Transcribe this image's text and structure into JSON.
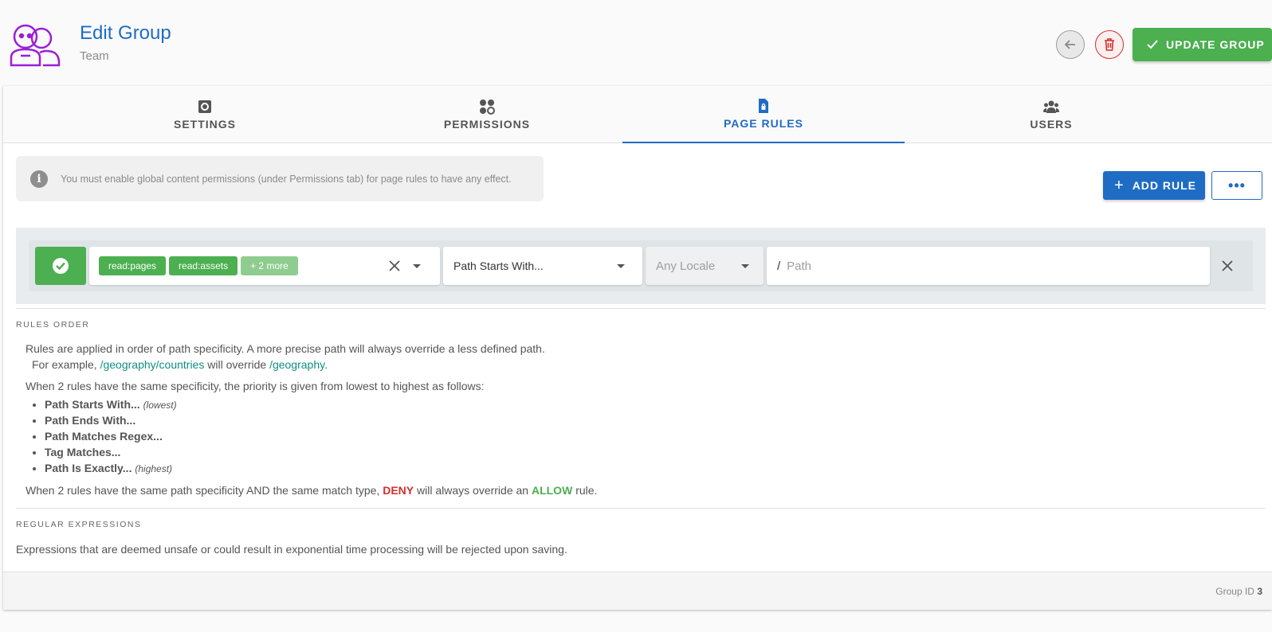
{
  "header": {
    "title": "Edit Group",
    "subtitle": "Team",
    "update_label": "UPDATE GROUP",
    "logo_icon": "users-group-logo",
    "back_icon": "arrow-left-icon",
    "delete_icon": "trash-icon"
  },
  "tabs": [
    {
      "label": "SETTINGS",
      "icon": "gear-icon"
    },
    {
      "label": "PERMISSIONS",
      "icon": "permissions-icon"
    },
    {
      "label": "PAGE RULES",
      "icon": "locked-file-icon",
      "active": true
    },
    {
      "label": "USERS",
      "icon": "users-icon"
    }
  ],
  "alert": {
    "text": "You must enable global content permissions (under Permissions tab) for page rules to have any effect."
  },
  "actions": {
    "add_rule_label": "ADD RULE",
    "more_label": "•••"
  },
  "rule": {
    "mode": "allow",
    "permissions": [
      "read:pages",
      "read:assets"
    ],
    "more_label": "+ 2 more",
    "match_type": "Path Starts With...",
    "locale_placeholder": "Any Locale",
    "path_prefix": "/",
    "path_placeholder": "Path"
  },
  "rules_order": {
    "title": "RULES ORDER",
    "intro": "Rules are applied in order of path specificity. A more precise path will always override a less defined path.",
    "example_prefix": "For example,",
    "example_path1": "/geography/countries",
    "example_mid": "will override",
    "example_path2": "/geography.",
    "priority_intro": "When 2 rules have the same specificity, the priority is given from lowest to highest as follows:",
    "items": [
      {
        "label": "Path Starts With...",
        "note": "(lowest)"
      },
      {
        "label": "Path Ends With...",
        "note": ""
      },
      {
        "label": "Path Matches Regex...",
        "note": ""
      },
      {
        "label": "Tag Matches...",
        "note": ""
      },
      {
        "label": "Path Is Exactly...",
        "note": "(highest)"
      }
    ],
    "conflict_prefix": "When 2 rules have the same path specificity AND the same match type,",
    "deny": "DENY",
    "conflict_mid": "will always override an",
    "allow": "ALLOW",
    "conflict_suffix": "rule."
  },
  "regex": {
    "title": "REGULAR EXPRESSIONS",
    "text": "Expressions that are deemed unsafe or could result in exponential time processing will be rejected upon saving."
  },
  "footer": {
    "group_id_label": "Group ID",
    "group_id": "3"
  },
  "colors": {
    "primary": "#1f6cc4",
    "success": "#4caf50",
    "danger": "#d32f2f",
    "logo": "#9b1fd6"
  }
}
